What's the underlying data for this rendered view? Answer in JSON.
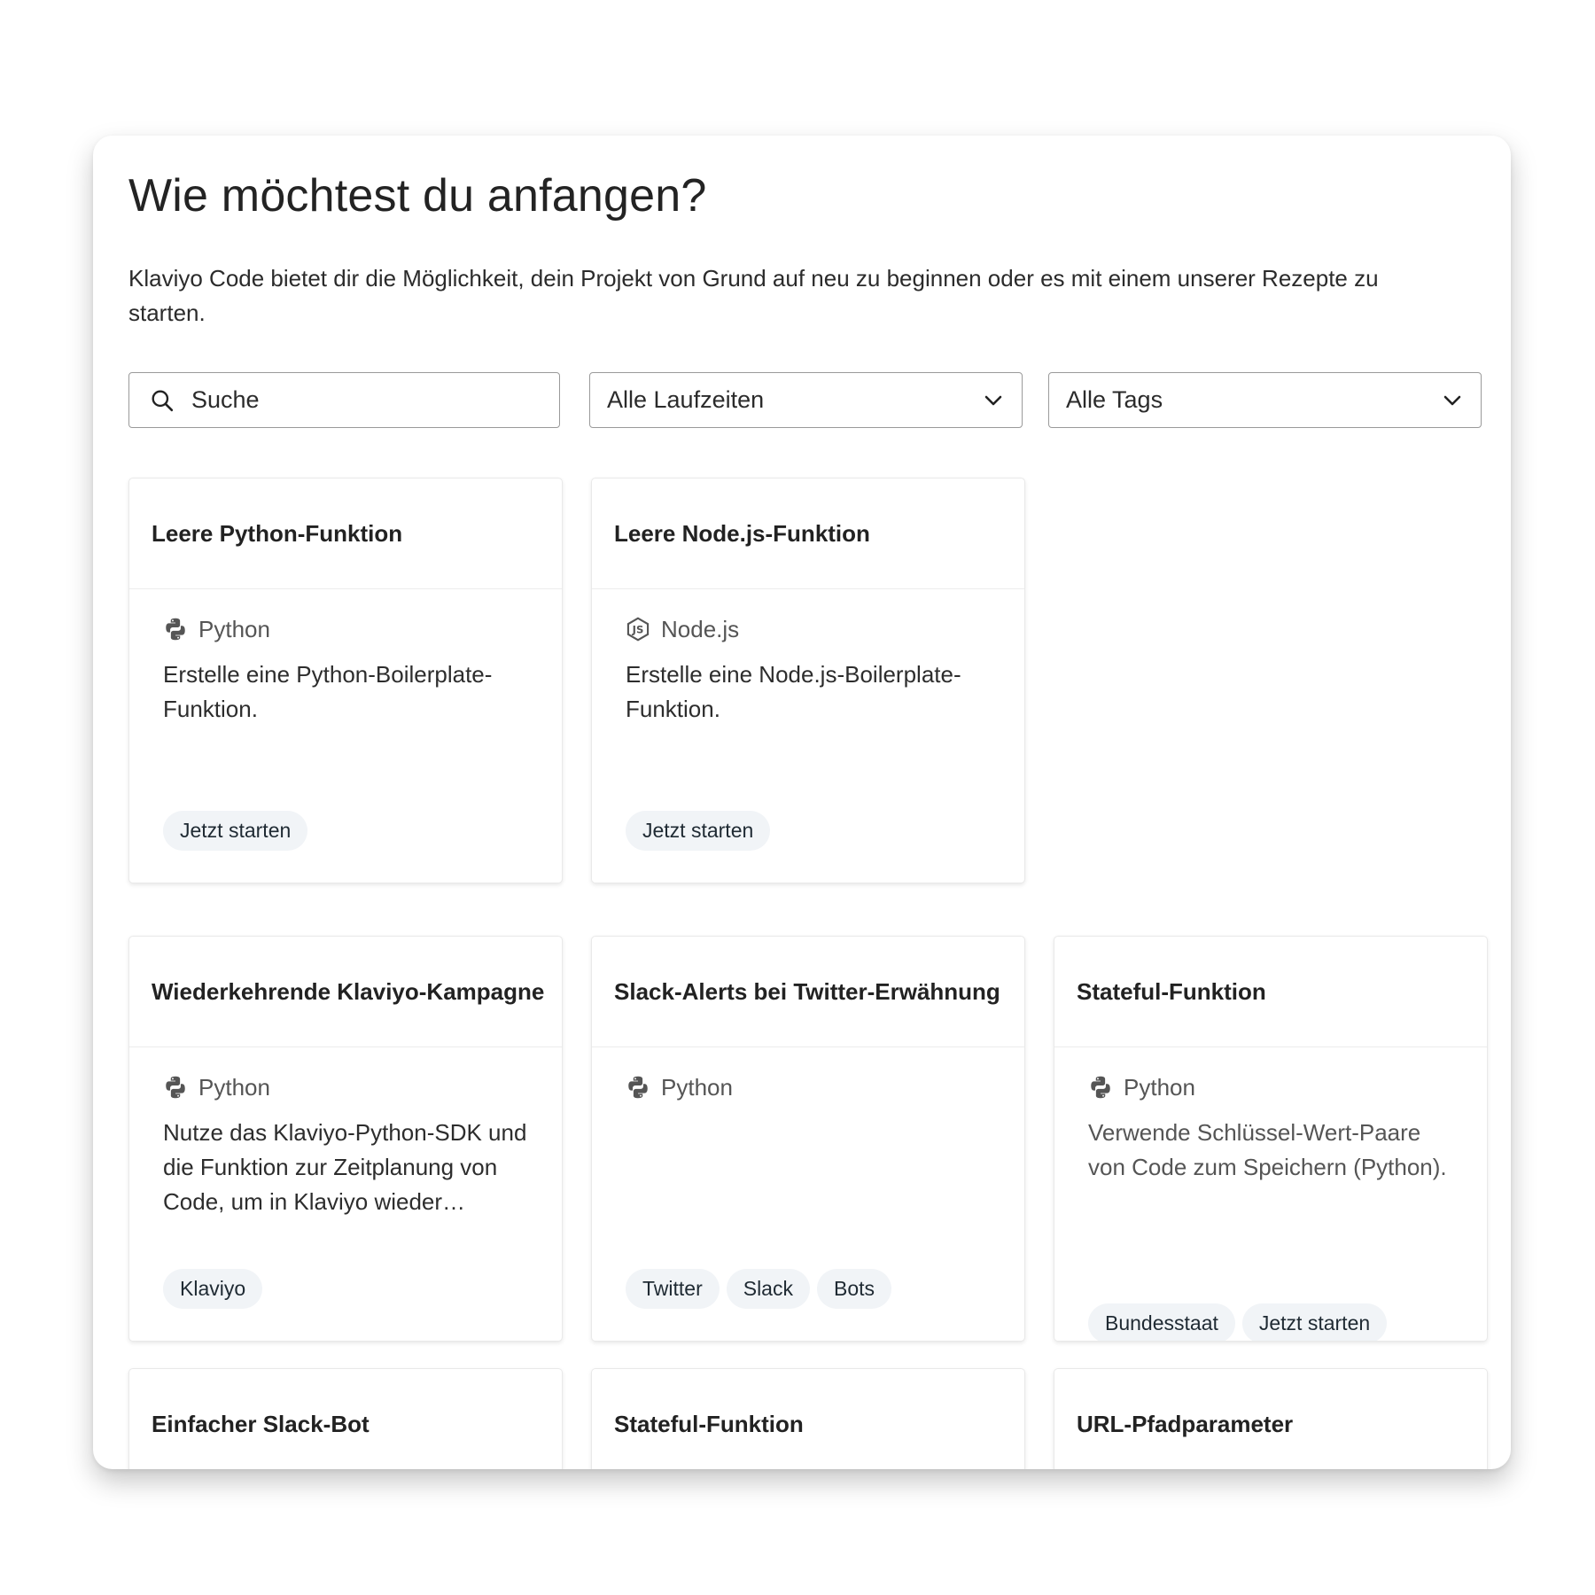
{
  "page": {
    "title": "Wie möchtest du anfangen?",
    "intro": "Klaviyo Code bietet dir die Möglichkeit, dein Projekt von Grund auf neu zu beginnen oder es mit einem unserer Rezepte zu starten."
  },
  "filters": {
    "search_placeholder": "Suche",
    "runtime_select": "Alle Laufzeiten",
    "tags_select": "Alle Tags"
  },
  "cards": [
    {
      "title": "Leere Python-Funktion",
      "runtime": "Python",
      "runtime_icon": "python-icon",
      "description": "Erstelle eine Python-Boilerplate-Funktion.",
      "tags": [
        "Jetzt starten"
      ]
    },
    {
      "title": "Leere Node.js-Funktion",
      "runtime": "Node.js",
      "runtime_icon": "nodejs-icon",
      "description": "Erstelle eine Node.js-Boilerplate-Funktion.",
      "tags": [
        "Jetzt starten"
      ]
    },
    {
      "title": "Wiederkehrende Klaviyo-Kampagne",
      "runtime": "Python",
      "runtime_icon": "python-icon",
      "description": "Nutze das Klaviyo-Python-SDK und die Funktion zur Zeitplanung von Code, um in Klaviyo wieder…",
      "tags": [
        "Klaviyo"
      ]
    },
    {
      "title": "Slack-Alerts bei Twitter-Erwähnung",
      "runtime": "Python",
      "runtime_icon": "python-icon",
      "description": "",
      "tags": [
        "Twitter",
        "Slack",
        "Bots"
      ]
    },
    {
      "title": "Stateful-Funktion",
      "runtime": "Python",
      "runtime_icon": "python-icon",
      "description": "Verwende Schlüssel-Wert-Paare von Code zum Speichern (Python).",
      "tags": [
        "Bundesstaat",
        "Jetzt starten"
      ]
    },
    {
      "title": "Einfacher Slack-Bot"
    },
    {
      "title": "Stateful-Funktion"
    },
    {
      "title": "URL-Pfadparameter"
    }
  ],
  "colors": {
    "tag_bg": "#f1f4f7",
    "border": "#9a9a9a",
    "text": "#2b2b2b"
  }
}
